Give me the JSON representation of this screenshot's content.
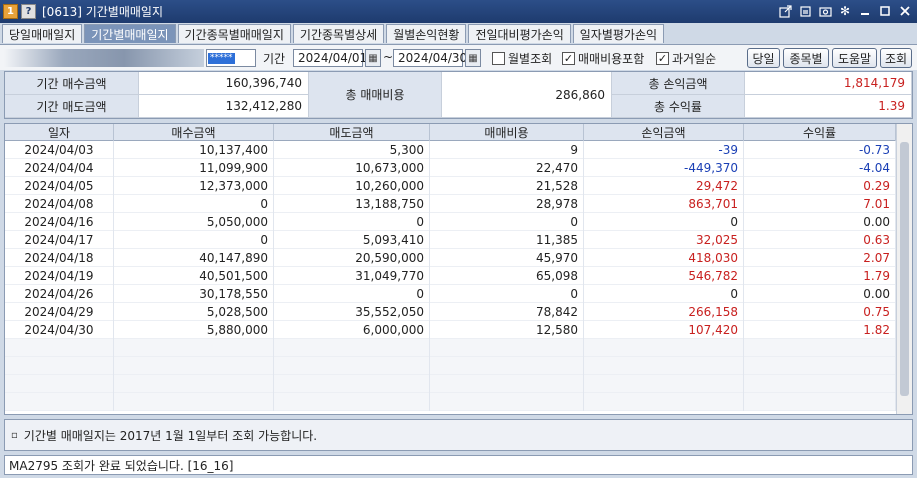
{
  "window": {
    "num_badge": "1",
    "help_badge": "?",
    "title": "[0613] 기간별매매일지",
    "icons": [
      "export-icon",
      "pin-icon",
      "camera-icon",
      "gear-icon",
      "minimize-icon",
      "maximize-icon",
      "close-icon"
    ]
  },
  "tabs": [
    {
      "label": "당일매매일지",
      "active": false
    },
    {
      "label": "기간별매매일지",
      "active": true
    },
    {
      "label": "기간종목별매매일지",
      "active": false
    },
    {
      "label": "기간종목별상세",
      "active": false
    },
    {
      "label": "월별손익현황",
      "active": false
    },
    {
      "label": "전일대비평가손익",
      "active": false
    },
    {
      "label": "일자별평가손익",
      "active": false
    }
  ],
  "toolbar": {
    "password_value": "*****",
    "period_label": "기간",
    "date_from": "2024/04/01",
    "tilde": "~",
    "date_to": "2024/04/30",
    "monthly": {
      "label": "월별조회",
      "checked": false
    },
    "include_fee": {
      "label": "매매비용포함",
      "checked": true
    },
    "past_order": {
      "label": "과거일순",
      "checked": true
    },
    "btn_today": "당일",
    "btn_stock": "종목별",
    "btn_help": "도움말",
    "btn_query": "조회"
  },
  "summary": {
    "buy_label": "기간 매수금액",
    "buy_value": "160,396,740",
    "sell_label": "기간 매도금액",
    "sell_value": "132,412,280",
    "fee_label": "총 매매비용",
    "fee_value": "286,860",
    "pl_label": "총 손익금액",
    "pl_value": "1,814,179",
    "rate_label": "총 수익률",
    "rate_value": "1.39"
  },
  "table": {
    "headers": [
      "일자",
      "매수금액",
      "매도금액",
      "매매비용",
      "손익금액",
      "수익률"
    ],
    "rows": [
      [
        "2024/04/03",
        "10,137,400",
        "5,300",
        "9",
        "-39",
        "-0.73"
      ],
      [
        "2024/04/04",
        "11,099,900",
        "10,673,000",
        "22,470",
        "-449,370",
        "-4.04"
      ],
      [
        "2024/04/05",
        "12,373,000",
        "10,260,000",
        "21,528",
        "29,472",
        "0.29"
      ],
      [
        "2024/04/08",
        "0",
        "13,188,750",
        "28,978",
        "863,701",
        "7.01"
      ],
      [
        "2024/04/16",
        "5,050,000",
        "0",
        "0",
        "0",
        "0.00"
      ],
      [
        "2024/04/17",
        "0",
        "5,093,410",
        "11,385",
        "32,025",
        "0.63"
      ],
      [
        "2024/04/18",
        "40,147,890",
        "20,590,000",
        "45,970",
        "418,030",
        "2.07"
      ],
      [
        "2024/04/19",
        "40,501,500",
        "31,049,770",
        "65,098",
        "546,782",
        "1.79"
      ],
      [
        "2024/04/26",
        "30,178,550",
        "0",
        "0",
        "0",
        "0.00"
      ],
      [
        "2024/04/29",
        "5,028,500",
        "35,552,050",
        "78,842",
        "266,158",
        "0.75"
      ],
      [
        "2024/04/30",
        "5,880,000",
        "6,000,000",
        "12,580",
        "107,420",
        "1.82"
      ]
    ]
  },
  "notice": {
    "bullet": "▫",
    "text": "기간별 매매일지는 2017년 1월 1일부터 조회 가능합니다."
  },
  "status": {
    "text": "MA2795 조회가 완료 되었습니다. [16_16]"
  },
  "colors": {
    "negative": "#1a3fb5",
    "positive": "#c8201f",
    "active_tab": "#7b94b9"
  }
}
